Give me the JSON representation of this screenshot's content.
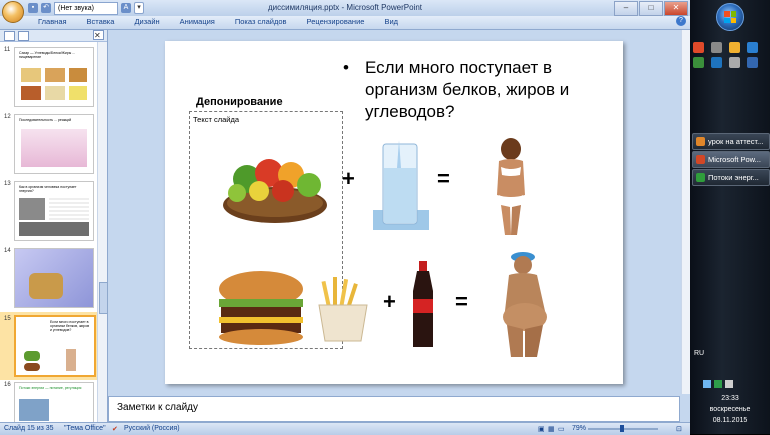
{
  "window": {
    "title": "диссимиляция.pptx - Microsoft PowerPoint",
    "undo_combo": "(Нет звука)"
  },
  "ribbon": {
    "tabs": [
      "Главная",
      "Вставка",
      "Дизайн",
      "Анимация",
      "Показ слайдов",
      "Рецензирование",
      "Вид"
    ]
  },
  "slides_pane": {
    "thumbnails": [
      {
        "number": "11",
        "text": "Сахар — Углеводы/Белки/Жиры ... пищеварение"
      },
      {
        "number": "12",
        "text": "Последовательность ... реакций"
      },
      {
        "number": "13",
        "text": "Как в организм человека поступает энергия?"
      },
      {
        "number": "14",
        "text": ""
      },
      {
        "number": "15",
        "text": "Если много поступает в организм белков, жиров и углеводов?",
        "selected": true
      },
      {
        "number": "16",
        "text": "Потоки энергии — питание, регуляция"
      }
    ]
  },
  "slide": {
    "bullet": "Если много поступает в организм белков, жиров и углеводов?",
    "heading": "Депонирование",
    "placeholder": "Текст слайда",
    "plus1": "+",
    "equals1": "=",
    "plus2": "+",
    "equals2": "="
  },
  "notes": {
    "placeholder": "Заметки к слайду"
  },
  "status": {
    "slide_counter": "Слайд 15 из 35",
    "theme": "\"Тема Office\"",
    "language": "Русский (Россия)",
    "zoom": "79%"
  },
  "taskbar": {
    "items": [
      {
        "label": "урок на аттест...",
        "color": "#e0862a"
      },
      {
        "label": "Microsoft Pow...",
        "color": "#d24726"
      },
      {
        "label": "Потоки энерг...",
        "color": "#2f9d3b"
      }
    ],
    "language": "RU",
    "time": "23:33",
    "day": "воскресенье",
    "date": "08.11.2015"
  }
}
